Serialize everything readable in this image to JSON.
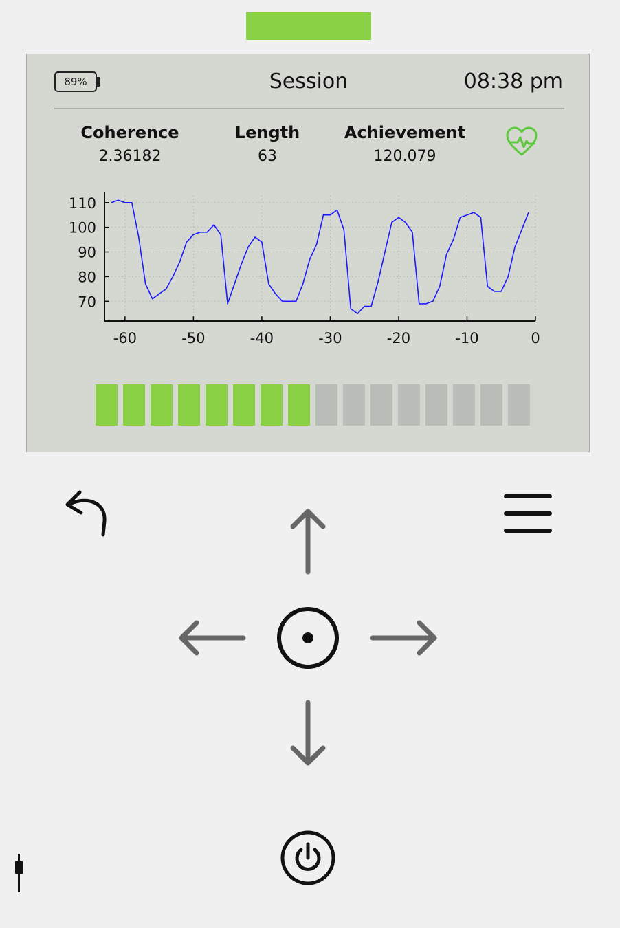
{
  "colors": {
    "accent_green": "#8ad145",
    "inactive_segment": "#babdb7",
    "screen_bg": "#d5d8d1",
    "line_blue": "#1a1aff",
    "arrow_gray": "#666666"
  },
  "header": {
    "battery": "89%",
    "title": "Session",
    "clock": "08:38 pm"
  },
  "stats": [
    {
      "label": "Coherence",
      "value": "2.36182"
    },
    {
      "label": "Length",
      "value": "63"
    },
    {
      "label": "Achievement",
      "value": "120.079"
    }
  ],
  "icons": {
    "heart": "heart-pulse-icon",
    "back": "back-arrow-icon",
    "menu": "menu-icon",
    "up": "arrow-up-icon",
    "down": "arrow-down-icon",
    "left": "arrow-left-icon",
    "right": "arrow-right-icon",
    "select": "select-circle-icon",
    "power": "power-icon",
    "plug": "plug-icon"
  },
  "coherence_level": {
    "filled": 8,
    "total": 16
  },
  "chart_data": {
    "type": "line",
    "xlim": [
      -63,
      0
    ],
    "ylim": [
      62,
      113
    ],
    "x_ticks": [
      -60,
      -50,
      -40,
      -30,
      -20,
      -10,
      0
    ],
    "y_ticks": [
      70,
      80,
      90,
      100,
      110
    ],
    "grid": true,
    "series": [
      {
        "x": [
          -62,
          -61,
          -60,
          -59,
          -58,
          -57,
          -56,
          -55,
          -54,
          -53,
          -52,
          -51,
          -50,
          -49,
          -48,
          -47,
          -46,
          -45,
          -44,
          -43,
          -42,
          -41,
          -40,
          -39,
          -38,
          -37,
          -36,
          -35,
          -34,
          -33,
          -32,
          -31,
          -30,
          -29,
          -28,
          -27,
          -26,
          -25,
          -24,
          -23,
          -22,
          -21,
          -20,
          -19,
          -18,
          -17,
          -16,
          -15,
          -14,
          -13,
          -12,
          -11,
          -10,
          -9,
          -8,
          -7,
          -6,
          -5,
          -4,
          -3,
          -2,
          -1
        ],
        "y": [
          110,
          111,
          110,
          110,
          96,
          77,
          71,
          73,
          75,
          80,
          86,
          94,
          97,
          98,
          98,
          101,
          97,
          69,
          77,
          85,
          92,
          96,
          94,
          77,
          73,
          70,
          70,
          70,
          77,
          87,
          93,
          105,
          105,
          107,
          99,
          67,
          65,
          68,
          68,
          78,
          90,
          102,
          104,
          102,
          98,
          69,
          69,
          70,
          76,
          89,
          95,
          104,
          105,
          106,
          104,
          76,
          74,
          74,
          80,
          92,
          99,
          106
        ]
      }
    ]
  }
}
